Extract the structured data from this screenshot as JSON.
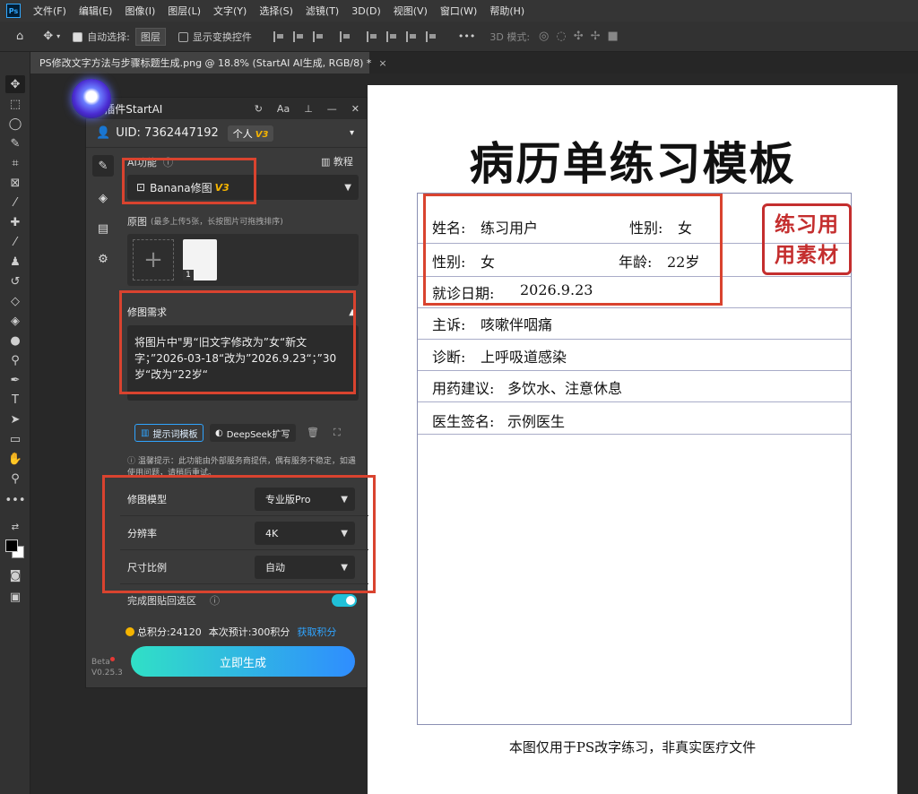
{
  "menubar": {
    "app_icon": "Ps",
    "items": [
      "文件(F)",
      "编辑(E)",
      "图像(I)",
      "图层(L)",
      "文字(Y)",
      "选择(S)",
      "滤镜(T)",
      "3D(D)",
      "视图(V)",
      "窗口(W)",
      "帮助(H)"
    ]
  },
  "options_bar": {
    "auto_select_label": "自动选择:",
    "auto_select_value": "图层",
    "show_transform_label": "显示变换控件",
    "more_label": "•••",
    "mode_3d_label": "3D 模式:"
  },
  "document_tab": {
    "title": "PS修改文字方法与步骤标题生成.png @ 18.8% (StartAI AI生成, RGB/8) *",
    "close": "×"
  },
  "document": {
    "title": "病历单练习模板",
    "stamp_line1": "练习用",
    "stamp_line2": "用素材",
    "fields": {
      "name_label": "姓名:",
      "name_value": "练习用户",
      "gender_label_1": "性别:",
      "gender_value_1": "女",
      "gender_label_2": "性别:",
      "gender_value_2": "女",
      "age_label": "年龄:",
      "age_value": "22岁",
      "visit_date_label": "就诊日期:",
      "visit_date_value": "2026.9.23",
      "complaint_label": "主诉:",
      "complaint_value": "咳嗽伴咽痛",
      "diagnosis_label": "诊断:",
      "diagnosis_value": "上呼吸道感染",
      "advice_label": "用药建议:",
      "advice_value": "多饮水、注意休息",
      "doctor_label": "医生签名:",
      "doctor_value": "示例医生"
    },
    "footer": "本图仅用于PS改字练习，非真实医疗文件"
  },
  "plugin": {
    "title": "Ps插件StartAI",
    "header_buttons": [
      "↻",
      "Aa",
      "⊥",
      "—",
      "✕"
    ],
    "uid_label": "UID: 7362447192",
    "account_type": "个人",
    "version_badge": "V3",
    "ai_feature_label": "AI功能",
    "tutorial_label": "教程",
    "feature_selected": "Banana修图",
    "feature_version": "V3",
    "original_label": "原图",
    "original_hint": "(最多上传5张，长按图片可拖拽排序)",
    "thumb_badge": "1",
    "requirement_label": "修图需求",
    "requirement_text": "将图片中\"男“旧文字修改为”女“新文字；”2026-03-18“改为”2026.9.23“；”30岁“改为”22岁“",
    "prompt_template_label": "提示词模板",
    "deepseek_label": "DeepSeek扩写",
    "notice": "温馨提示：此功能由外部服务商提供，偶有服务不稳定，如遇使用问题，请稍后重试。",
    "model_label": "修图模型",
    "model_value": "专业版Pro",
    "resolution_label": "分辨率",
    "resolution_value": "4K",
    "ratio_label": "尺寸比例",
    "ratio_value": "自动",
    "paste_back_label": "完成图贴回选区",
    "paste_back_on": true,
    "credits_total": "总积分:24120",
    "credits_estimate": "本次预计:300积分",
    "get_credits_label": "获取积分",
    "generate_label": "立即生成",
    "beta_label": "Beta",
    "version_label": "V0.25.3"
  },
  "colors": {
    "accent_blue": "#2fa4ff",
    "gold": "#f5b400",
    "highlight_red": "#d9432f",
    "stamp_red": "#c42e2e",
    "generate_gradient_start": "#30e0c6",
    "generate_gradient_end": "#2f8dff"
  }
}
